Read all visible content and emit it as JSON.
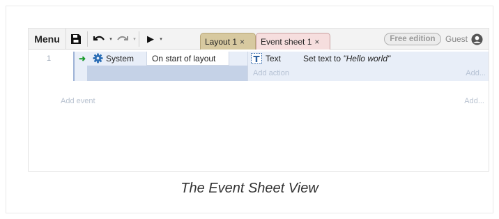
{
  "toolbar": {
    "menu_label": "Menu",
    "save_icon": "floppy-disk-icon",
    "undo_icon": "undo-icon",
    "redo_icon": "redo-icon",
    "play_icon": "play-icon",
    "dropdown_glyph": "▾",
    "play_glyph": "▶",
    "tabs": [
      {
        "label": "Layout 1",
        "close": "×"
      },
      {
        "label": "Event sheet 1",
        "close": "×"
      }
    ],
    "edition_badge": "Free edition",
    "user_label": "Guest",
    "user_icon": "user-circle-icon"
  },
  "event_sheet": {
    "events": [
      {
        "number": "1",
        "trigger_glyph": "➜",
        "condition": {
          "object_icon": "gear-icon",
          "object": "System",
          "text": "On start of layout"
        },
        "action": {
          "object_icon": "text-object-icon",
          "object": "Text",
          "text_prefix": "Set text to ",
          "text_value": "\"Hello world\""
        },
        "add_action_label": "Add action",
        "add_right_label": "Add..."
      }
    ],
    "add_event_label": "Add event",
    "add_right_label": "Add..."
  },
  "caption": "The Event Sheet View",
  "colors": {
    "layout_tab": "#d7c9a0",
    "event_tab": "#f6dede",
    "event_block": "#e8eef8",
    "condition_band": "#c5d2e7",
    "trigger_arrow": "#1a9a2c"
  }
}
